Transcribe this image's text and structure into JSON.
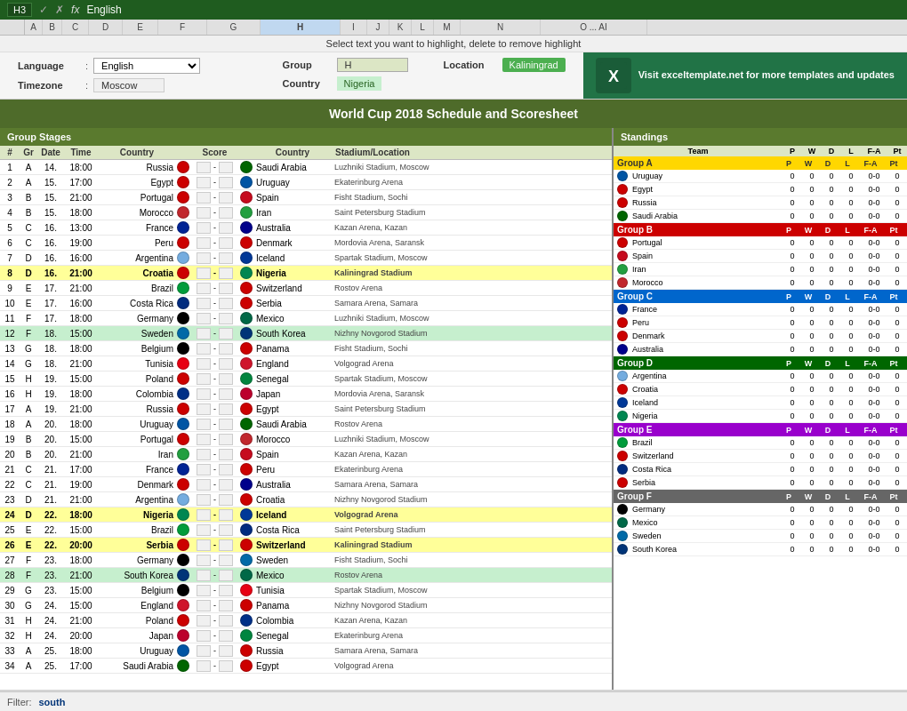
{
  "titlebar": {
    "cell_ref": "H3",
    "formula_content": "English",
    "window_controls": [
      "×",
      "—",
      "□"
    ]
  },
  "instruction": "Select text you want to highlight, delete to remove highlight",
  "settings": {
    "language_label": "Language",
    "language_value": "English",
    "timezone_label": "Timezone",
    "timezone_value": "Moscow",
    "group_label": "Group",
    "group_value": "H",
    "country_label": "Country",
    "country_value": "Nigeria",
    "location_label": "Location",
    "location_value": "Kaliningrad",
    "excel_promo": "Visit exceltemplate.net for more templates and updates"
  },
  "main_title": "World Cup 2018 Schedule and Scoresheet",
  "group_stages_header": "Group Stages",
  "standings_header": "Standings",
  "table_columns": [
    "#",
    "Gr",
    "Date",
    "Time",
    "Country",
    "",
    "Score",
    "",
    "Country",
    "Stadium/Location"
  ],
  "matches": [
    {
      "num": 1,
      "grp": "A",
      "date": "14.",
      "time": "18:00",
      "home": "Russia",
      "away": "Saudi Arabia",
      "venue": "Luzhniki Stadium, Moscow",
      "hl": false
    },
    {
      "num": 2,
      "grp": "A",
      "date": "15.",
      "time": "17:00",
      "home": "Egypt",
      "away": "Uruguay",
      "venue": "Ekaterinburg Arena",
      "hl": false
    },
    {
      "num": 3,
      "grp": "B",
      "date": "15.",
      "time": "21:00",
      "home": "Portugal",
      "away": "Spain",
      "venue": "Fisht Stadium, Sochi",
      "hl": false
    },
    {
      "num": 4,
      "grp": "B",
      "date": "15.",
      "time": "18:00",
      "home": "Morocco",
      "away": "Iran",
      "venue": "Saint Petersburg Stadium",
      "hl": false
    },
    {
      "num": 5,
      "grp": "C",
      "date": "16.",
      "time": "13:00",
      "home": "France",
      "away": "Australia",
      "venue": "Kazan Arena, Kazan",
      "hl": false
    },
    {
      "num": 6,
      "grp": "C",
      "date": "16.",
      "time": "19:00",
      "home": "Peru",
      "away": "Denmark",
      "venue": "Mordovia Arena, Saransk",
      "hl": false
    },
    {
      "num": 7,
      "grp": "D",
      "date": "16.",
      "time": "16:00",
      "home": "Argentina",
      "away": "Iceland",
      "venue": "Spartak Stadium, Moscow",
      "hl": false
    },
    {
      "num": 8,
      "grp": "D",
      "date": "16.",
      "time": "21:00",
      "home": "Croatia",
      "away": "Nigeria",
      "venue": "Kaliningrad Stadium",
      "hl": true,
      "hl_color": "yellow"
    },
    {
      "num": 9,
      "grp": "E",
      "date": "17.",
      "time": "21:00",
      "home": "Brazil",
      "away": "Switzerland",
      "venue": "Rostov Arena",
      "hl": false
    },
    {
      "num": 10,
      "grp": "E",
      "date": "17.",
      "time": "16:00",
      "home": "Costa Rica",
      "away": "Serbia",
      "venue": "Samara Arena, Samara",
      "hl": false
    },
    {
      "num": 11,
      "grp": "F",
      "date": "17.",
      "time": "18:00",
      "home": "Germany",
      "away": "Mexico",
      "venue": "Luzhniki Stadium, Moscow",
      "hl": false
    },
    {
      "num": 12,
      "grp": "F",
      "date": "18.",
      "time": "15:00",
      "home": "Sweden",
      "away": "South Korea",
      "venue": "Nizhny Novgorod Stadium",
      "hl": false
    },
    {
      "num": 13,
      "grp": "G",
      "date": "18.",
      "time": "18:00",
      "home": "Belgium",
      "away": "Panama",
      "venue": "Fisht Stadium, Sochi",
      "hl": false
    },
    {
      "num": 14,
      "grp": "G",
      "date": "18.",
      "time": "21:00",
      "home": "Tunisia",
      "away": "England",
      "venue": "Volgograd Arena",
      "hl": false
    },
    {
      "num": 15,
      "grp": "H",
      "date": "19.",
      "time": "15:00",
      "home": "Poland",
      "away": "Senegal",
      "venue": "Spartak Stadium, Moscow",
      "hl": false
    },
    {
      "num": 16,
      "grp": "H",
      "date": "19.",
      "time": "18:00",
      "home": "Colombia",
      "away": "Japan",
      "venue": "Mordovia Arena, Saransk",
      "hl": false
    },
    {
      "num": 17,
      "grp": "A",
      "date": "19.",
      "time": "21:00",
      "home": "Russia",
      "away": "Egypt",
      "venue": "Saint Petersburg Stadium",
      "hl": false
    },
    {
      "num": 18,
      "grp": "A",
      "date": "20.",
      "time": "18:00",
      "home": "Uruguay",
      "away": "Saudi Arabia",
      "venue": "Rostov Arena",
      "hl": false
    },
    {
      "num": 19,
      "grp": "B",
      "date": "20.",
      "time": "15:00",
      "home": "Portugal",
      "away": "Morocco",
      "venue": "Luzhniki Stadium, Moscow",
      "hl": false
    },
    {
      "num": 20,
      "grp": "B",
      "date": "20.",
      "time": "21:00",
      "home": "Iran",
      "away": "Spain",
      "venue": "Kazan Arena, Kazan",
      "hl": false
    },
    {
      "num": 21,
      "grp": "C",
      "date": "21.",
      "time": "17:00",
      "home": "France",
      "away": "Peru",
      "venue": "Ekaterinburg Arena",
      "hl": false
    },
    {
      "num": 22,
      "grp": "C",
      "date": "21.",
      "time": "19:00",
      "home": "Denmark",
      "away": "Australia",
      "venue": "Samara Arena, Samara",
      "hl": false
    },
    {
      "num": 23,
      "grp": "D",
      "date": "21.",
      "time": "21:00",
      "home": "Argentina",
      "away": "Croatia",
      "venue": "Nizhny Novgorod Stadium",
      "hl": false
    },
    {
      "num": 24,
      "grp": "D",
      "date": "22.",
      "time": "18:00",
      "home": "Nigeria",
      "away": "Iceland",
      "venue": "Volgograd Arena",
      "hl": true,
      "hl_color": "yellow"
    },
    {
      "num": 25,
      "grp": "E",
      "date": "22.",
      "time": "15:00",
      "home": "Brazil",
      "away": "Costa Rica",
      "venue": "Saint Petersburg Stadium",
      "hl": false
    },
    {
      "num": 26,
      "grp": "E",
      "date": "22.",
      "time": "20:00",
      "home": "Serbia",
      "away": "Switzerland",
      "venue": "Kaliningrad Stadium",
      "hl": true,
      "hl_color": "yellow"
    },
    {
      "num": 27,
      "grp": "F",
      "date": "23.",
      "time": "18:00",
      "home": "Germany",
      "away": "Sweden",
      "venue": "Fisht Stadium, Sochi",
      "hl": false
    },
    {
      "num": 28,
      "grp": "F",
      "date": "23.",
      "time": "21:00",
      "home": "South Korea",
      "away": "Mexico",
      "venue": "Rostov Arena",
      "hl": false
    },
    {
      "num": 29,
      "grp": "G",
      "date": "23.",
      "time": "15:00",
      "home": "Belgium",
      "away": "Tunisia",
      "venue": "Spartak Stadium, Moscow",
      "hl": false
    },
    {
      "num": 30,
      "grp": "G",
      "date": "24.",
      "time": "15:00",
      "home": "England",
      "away": "Panama",
      "venue": "Nizhny Novgorod Stadium",
      "hl": false
    },
    {
      "num": 31,
      "grp": "H",
      "date": "24.",
      "time": "21:00",
      "home": "Poland",
      "away": "Colombia",
      "venue": "Kazan Arena, Kazan",
      "hl": false
    },
    {
      "num": 32,
      "grp": "H",
      "date": "24.",
      "time": "20:00",
      "home": "Japan",
      "away": "Senegal",
      "venue": "Ekaterinburg Arena",
      "hl": false
    },
    {
      "num": 33,
      "grp": "A",
      "date": "25.",
      "time": "18:00",
      "home": "Uruguay",
      "away": "Russia",
      "venue": "Samara Arena, Samara",
      "hl": false
    },
    {
      "num": 34,
      "grp": "A",
      "date": "25.",
      "time": "17:00",
      "home": "Saudi Arabia",
      "away": "Egypt",
      "venue": "Volgograd Arena",
      "hl": false
    }
  ],
  "standings_groups": [
    {
      "name": "Group A",
      "color_class": "grp-a",
      "teams": [
        {
          "name": "Uruguay",
          "p": 0,
          "w": 0,
          "d": 0,
          "l": 0,
          "fa": "0-0",
          "pt": 0
        },
        {
          "name": "Egypt",
          "p": 0,
          "w": 0,
          "d": 0,
          "l": 0,
          "fa": "0-0",
          "pt": 0
        },
        {
          "name": "Russia",
          "p": 0,
          "w": 0,
          "d": 0,
          "l": 0,
          "fa": "0-0",
          "pt": 0
        },
        {
          "name": "Saudi Arabia",
          "p": 0,
          "w": 0,
          "d": 0,
          "l": 0,
          "fa": "0-0",
          "pt": 0
        }
      ]
    },
    {
      "name": "Group B",
      "color_class": "grp-b",
      "teams": [
        {
          "name": "Portugal",
          "p": 0,
          "w": 0,
          "d": 0,
          "l": 0,
          "fa": "0-0",
          "pt": 0
        },
        {
          "name": "Spain",
          "p": 0,
          "w": 0,
          "d": 0,
          "l": 0,
          "fa": "0-0",
          "pt": 0
        },
        {
          "name": "Iran",
          "p": 0,
          "w": 0,
          "d": 0,
          "l": 0,
          "fa": "0-0",
          "pt": 0
        },
        {
          "name": "Morocco",
          "p": 0,
          "w": 0,
          "d": 0,
          "l": 0,
          "fa": "0-0",
          "pt": 0
        }
      ]
    },
    {
      "name": "Group C",
      "color_class": "grp-c",
      "teams": [
        {
          "name": "France",
          "p": 0,
          "w": 0,
          "d": 0,
          "l": 0,
          "fa": "0-0",
          "pt": 0
        },
        {
          "name": "Peru",
          "p": 0,
          "w": 0,
          "d": 0,
          "l": 0,
          "fa": "0-0",
          "pt": 0
        },
        {
          "name": "Denmark",
          "p": 0,
          "w": 0,
          "d": 0,
          "l": 0,
          "fa": "0-0",
          "pt": 0
        },
        {
          "name": "Australia",
          "p": 0,
          "w": 0,
          "d": 0,
          "l": 0,
          "fa": "0-0",
          "pt": 0
        }
      ]
    },
    {
      "name": "Group D",
      "color_class": "grp-d",
      "teams": [
        {
          "name": "Argentina",
          "p": 0,
          "w": 0,
          "d": 0,
          "l": 0,
          "fa": "0-0",
          "pt": 0
        },
        {
          "name": "Croatia",
          "p": 0,
          "w": 0,
          "d": 0,
          "l": 0,
          "fa": "0-0",
          "pt": 0
        },
        {
          "name": "Iceland",
          "p": 0,
          "w": 0,
          "d": 0,
          "l": 0,
          "fa": "0-0",
          "pt": 0
        },
        {
          "name": "Nigeria",
          "p": 0,
          "w": 0,
          "d": 0,
          "l": 0,
          "fa": "0-0",
          "pt": 0
        }
      ]
    },
    {
      "name": "Group E",
      "color_class": "grp-e",
      "teams": [
        {
          "name": "Brazil",
          "p": 0,
          "w": 0,
          "d": 0,
          "l": 0,
          "fa": "0-0",
          "pt": 0
        },
        {
          "name": "Switzerland",
          "p": 0,
          "w": 0,
          "d": 0,
          "l": 0,
          "fa": "0-0",
          "pt": 0
        },
        {
          "name": "Costa Rica",
          "p": 0,
          "w": 0,
          "d": 0,
          "l": 0,
          "fa": "0-0",
          "pt": 0
        },
        {
          "name": "Serbia",
          "p": 0,
          "w": 0,
          "d": 0,
          "l": 0,
          "fa": "0-0",
          "pt": 0
        }
      ]
    },
    {
      "name": "Group F",
      "color_class": "grp-f",
      "teams": [
        {
          "name": "Germany",
          "p": 0,
          "w": 0,
          "d": 0,
          "l": 0,
          "fa": "0-0",
          "pt": 0
        },
        {
          "name": "Mexico",
          "p": 0,
          "w": 0,
          "d": 0,
          "l": 0,
          "fa": "0-0",
          "pt": 0
        },
        {
          "name": "Sweden",
          "p": 0,
          "w": 0,
          "d": 0,
          "l": 0,
          "fa": "0-0",
          "pt": 0
        },
        {
          "name": "South Korea",
          "p": 0,
          "w": 0,
          "d": 0,
          "l": 0,
          "fa": "0-0",
          "pt": 0
        }
      ]
    }
  ],
  "flag_colors": {
    "Russia": "#cc0000",
    "Saudi Arabia": "#006600",
    "Egypt": "#cc0000",
    "Uruguay": "#0055a4",
    "Portugal": "#cc0000",
    "Spain": "#c60b1e",
    "Morocco": "#c1272d",
    "Iran": "#239f40",
    "France": "#002395",
    "Australia": "#00008b",
    "Peru": "#cc0000",
    "Denmark": "#cc0000",
    "Argentina": "#74acdf",
    "Iceland": "#003897",
    "Croatia": "#cc0000",
    "Nigeria": "#008751",
    "Brazil": "#009c3b",
    "Switzerland": "#cc0000",
    "Costa Rica": "#002b7f",
    "Serbia": "#cc0000",
    "Germany": "#000000",
    "Mexico": "#006847",
    "Sweden": "#006aa7",
    "South Korea": "#003478",
    "Belgium": "#000000",
    "Panama": "#cc0000",
    "Tunisia": "#e70013",
    "England": "#cf142b",
    "Poland": "#cc0000",
    "Senegal": "#00853f",
    "Colombia": "#003087",
    "Japan": "#bc002d"
  },
  "search_filter": "south"
}
